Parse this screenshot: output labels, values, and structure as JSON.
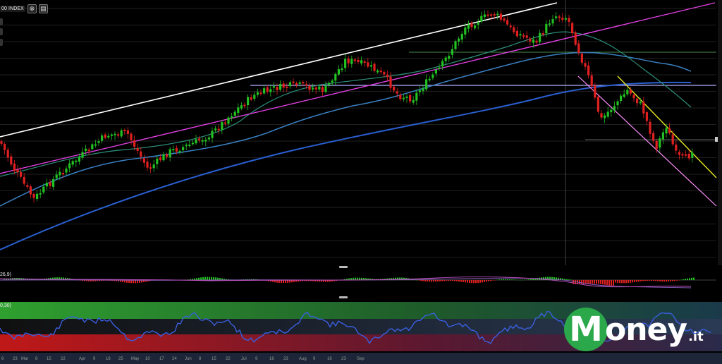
{
  "toolbar": {
    "index_label": "00 INDEX",
    "close_glyph": "⊗",
    "settings_glyph": "▤"
  },
  "panes": {
    "macd_label": "26,9)",
    "osc_label": "0,30)"
  },
  "axis": {
    "dates": [
      "6",
      "23",
      "Mar",
      "8",
      "15",
      "22",
      "Apr",
      "9",
      "16",
      "25",
      "May",
      "10",
      "17",
      "24",
      "Jun",
      "8",
      "15",
      "22",
      "Jul",
      "9",
      "16",
      "23",
      "Aug",
      "9",
      "16",
      "23",
      "Sep"
    ]
  },
  "logo": {
    "m": "M",
    "text": "oney",
    "tld": ".it"
  },
  "colors": {
    "up": "#22c022",
    "down": "#e02020",
    "trend_white": "#ffffff",
    "trend_magenta": "#e040e0",
    "ma_blue": "#2a5fd0",
    "ma_teal": "#2e8f7a",
    "ma_steel": "#3a7fc0",
    "lavender": "#b0b0ff",
    "yellow": "#e8e820",
    "pink": "#ff90ff",
    "green_level": "#4a8a4a"
  }
}
